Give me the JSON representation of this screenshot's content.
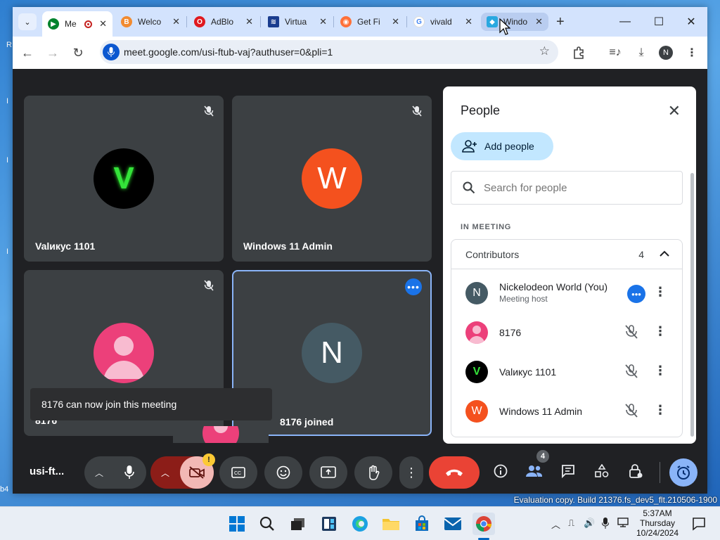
{
  "desktop": {
    "edge_chars": [
      "R",
      "I",
      "I",
      "I",
      "b4"
    ],
    "eval_watermark": "Evaluation copy. Build 21376.fs_dev5_flt.210506-1900"
  },
  "browser": {
    "tabs": [
      {
        "title": "Me",
        "icon": "meet-icon",
        "color": "#00832d"
      },
      {
        "title": "Welco",
        "icon": "welcome-icon",
        "color": "#f28b30"
      },
      {
        "title": "AdBlo",
        "icon": "opera-icon",
        "color": "#e0191f"
      },
      {
        "title": "Virtua",
        "icon": "virtual-icon",
        "color": "#1a3d8f"
      },
      {
        "title": "Get Fi",
        "icon": "firefox-icon",
        "color": "#ff7139"
      },
      {
        "title": "vivald",
        "icon": "google-icon",
        "color": "#4285f4"
      },
      {
        "title": "Windo",
        "icon": "windows-icon",
        "color": "#29a8e0"
      }
    ],
    "url": "meet.google.com/usi-ftub-vaj?authuser=0&pli=1",
    "profile_initial": "N"
  },
  "meet": {
    "tiles": [
      {
        "name": "Valикус 1101",
        "initial": "V"
      },
      {
        "name": "Windows 11 Admin",
        "initial": "W"
      },
      {
        "name": "8176",
        "initial": ""
      },
      {
        "name": "8176 joined",
        "initial": "N"
      }
    ],
    "toast": "8176 can now join this meeting",
    "meeting_code": "usi-ft...",
    "people_badge": "4",
    "cam_badge": "!"
  },
  "people_panel": {
    "title": "People",
    "add_people_label": "Add people",
    "search_placeholder": "Search for people",
    "section_label": "IN MEETING",
    "group_label": "Contributors",
    "group_count": "4",
    "members": [
      {
        "name": "Nickelodeon World (You)",
        "sub": "Meeting host",
        "initial": "N",
        "color": "#455a64"
      },
      {
        "name": "8176",
        "sub": "",
        "initial": "",
        "color": "#ec407a"
      },
      {
        "name": "Valикус 1101",
        "sub": "",
        "initial": "V",
        "color": "#000000"
      },
      {
        "name": "Windows 11 Admin",
        "sub": "",
        "initial": "W",
        "color": "#f4511e"
      }
    ]
  },
  "taskbar": {
    "time": "5:37AM",
    "day": "Thursday",
    "date": "10/24/2024"
  }
}
